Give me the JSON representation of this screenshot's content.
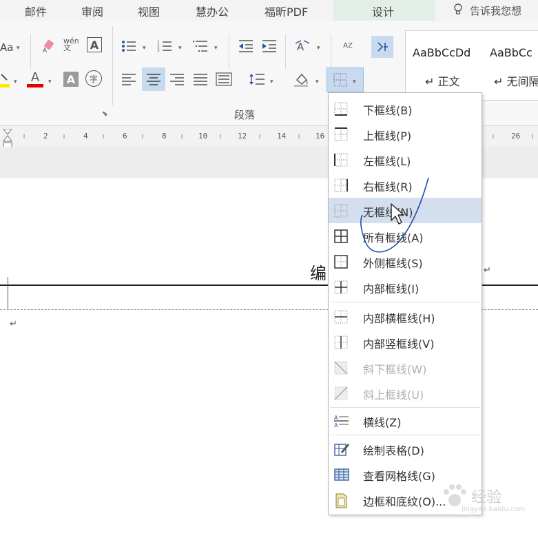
{
  "tabs": [
    "邮件",
    "审阅",
    "视图",
    "慧办公",
    "福昕PDF",
    "设计"
  ],
  "tell_me": "告诉我您想",
  "ribbon": {
    "font_size_fragment": "Aa",
    "phonetic_label": "wén文",
    "char_border_label": "A",
    "font_color_label": "A",
    "char_shading_label": "A",
    "enclose_label": "字",
    "sort_label": "AZ",
    "group_label": "段落",
    "styles": [
      {
        "preview": "AaBbCcDd",
        "name": "↵ 正文"
      },
      {
        "preview": "AaBbCc",
        "name": "↵ 无间隔"
      }
    ]
  },
  "ruler_numbers": [
    "2",
    "4",
    "6",
    "8",
    "10",
    "12",
    "14",
    "16",
    "26"
  ],
  "document": {
    "heading_fragment": "编",
    "paragraph_mark": "↵"
  },
  "border_menu": {
    "highlighted_index": 4,
    "items": [
      {
        "label": "下框线(B)",
        "icon": "bottom-border-icon",
        "enabled": true
      },
      {
        "label": "上框线(P)",
        "icon": "top-border-icon",
        "enabled": true
      },
      {
        "label": "左框线(L)",
        "icon": "left-border-icon",
        "enabled": true
      },
      {
        "label": "右框线(R)",
        "icon": "right-border-icon",
        "enabled": true
      },
      {
        "label": "无框线(N)",
        "icon": "no-border-icon",
        "enabled": true
      },
      {
        "label": "所有框线(A)",
        "icon": "all-borders-icon",
        "enabled": true
      },
      {
        "label": "外侧框线(S)",
        "icon": "outside-borders-icon",
        "enabled": true
      },
      {
        "label": "内部框线(I)",
        "icon": "inside-borders-icon",
        "enabled": true
      },
      {
        "label": "内部横框线(H)",
        "icon": "inside-horizontal-border-icon",
        "enabled": true
      },
      {
        "label": "内部竖框线(V)",
        "icon": "inside-vertical-border-icon",
        "enabled": true
      },
      {
        "label": "斜下框线(W)",
        "icon": "diagonal-down-border-icon",
        "enabled": false
      },
      {
        "label": "斜上框线(U)",
        "icon": "diagonal-up-border-icon",
        "enabled": false
      },
      {
        "label": "横线(Z)",
        "icon": "horizontal-line-icon",
        "enabled": true
      },
      {
        "label": "绘制表格(D)",
        "icon": "draw-table-icon",
        "enabled": true
      },
      {
        "label": "查看网格线(G)",
        "icon": "view-gridlines-icon",
        "enabled": true
      },
      {
        "label": "边框和底纹(O)...",
        "icon": "borders-shading-icon",
        "enabled": true
      }
    ]
  },
  "watermark": {
    "text": "经验",
    "subtext": "jingyan.baidu.com"
  },
  "colors": {
    "accent": "#2b579a",
    "highlight": "#d3deef",
    "font_color_red": "#e00000",
    "highlight_yellow": "#f5f000"
  }
}
